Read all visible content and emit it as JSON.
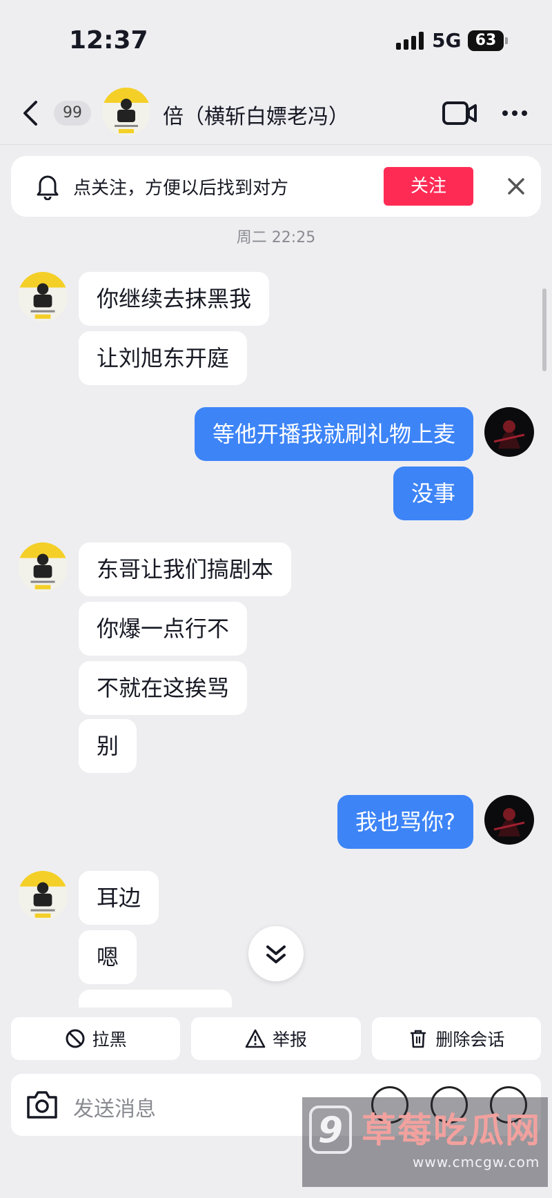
{
  "status_bar": {
    "time": "12:37",
    "network": "5G",
    "battery": "63"
  },
  "header": {
    "unread_count": "99",
    "peer_name": "倍（横斩白嫖老冯）"
  },
  "follow_banner": {
    "text": "点关注，方便以后找到对方",
    "button_label": "关注"
  },
  "conversation": {
    "timestamp": "周二 22:25",
    "messages": [
      {
        "side": "in",
        "text": "你继续去抹黑我"
      },
      {
        "side": "in",
        "text": "让刘旭东开庭"
      },
      {
        "side": "out",
        "text": "等他开播我就刷礼物上麦"
      },
      {
        "side": "out",
        "text": "没事"
      },
      {
        "side": "in",
        "text": "东哥让我们搞剧本"
      },
      {
        "side": "in",
        "text": "你爆一点行不"
      },
      {
        "side": "in",
        "text": "不就在这挨骂"
      },
      {
        "side": "in",
        "text": "别"
      },
      {
        "side": "out",
        "text": "我也骂你?"
      },
      {
        "side": "in",
        "text": "耳边"
      },
      {
        "side": "in",
        "text": "嗯"
      }
    ]
  },
  "actions": {
    "block": "拉黑",
    "report": "举报",
    "delete": "删除会话"
  },
  "input": {
    "placeholder": "发送消息"
  },
  "watermark": {
    "logo": "9",
    "name": "草莓吃瓜网",
    "url": "www.cmcgw.com"
  },
  "colors": {
    "follow": "#fe2c55",
    "outgoing_bubble": "#3d84f7",
    "background": "#eeeef1"
  }
}
